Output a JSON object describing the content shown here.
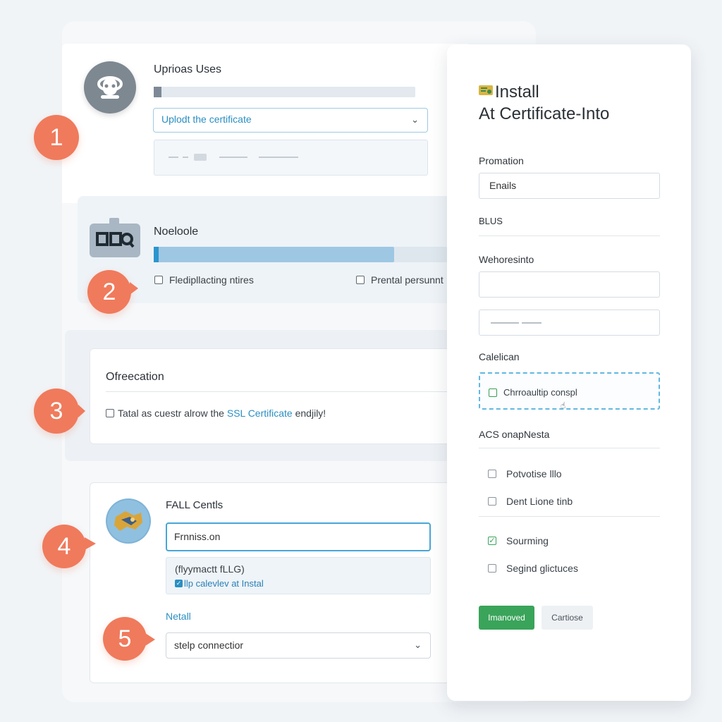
{
  "steps": [
    {
      "number": "1",
      "title": "Uprioas Uses",
      "progress": 0.03,
      "select_value": "Uplodt the certificate"
    },
    {
      "number": "2",
      "title": "Noeloole",
      "progress": 0.8,
      "checkboxes": [
        "Fledipllacting ntires",
        "Prental persunnt"
      ]
    },
    {
      "number": "3",
      "title": "Ofreecation",
      "checkbox_text": "Tatal as cuestr alrow the ",
      "checkbox_link": "SSL Certificate",
      "checkbox_suffix": " endjily!"
    },
    {
      "number": "4",
      "title": "FALL Centls",
      "input_value": "Frnniss.on",
      "note_line1": "(flyymactt fLLG)",
      "note_line2": "llp calevlev at Instal"
    },
    {
      "number": "5",
      "title": "Netall",
      "select_value": "stelp connectior"
    }
  ],
  "dialog": {
    "title_line1": "Install",
    "title_line2": "At Certificate-Into",
    "section1_label": "Promation",
    "section1_input": "Enails",
    "section1_value": "BLUS",
    "section2_label": "Wehoresinto",
    "section3_label": "Calelican",
    "section3_checkbox": "Chrroaultip conspl",
    "section4_value": "ACS onapNesta",
    "options": [
      {
        "label": "Potvotise lllo",
        "checked": false
      },
      {
        "label": "Dent Lione tinb",
        "checked": false
      },
      {
        "label": "Sourming",
        "checked": true
      },
      {
        "label": "Segind glictuces",
        "checked": false
      }
    ],
    "primary_button": "Imanoved",
    "secondary_button": "Cartiose"
  },
  "colors": {
    "badge": "#f07a5c",
    "accent_blue": "#2a8fc2",
    "primary_green": "#3aa45a"
  }
}
